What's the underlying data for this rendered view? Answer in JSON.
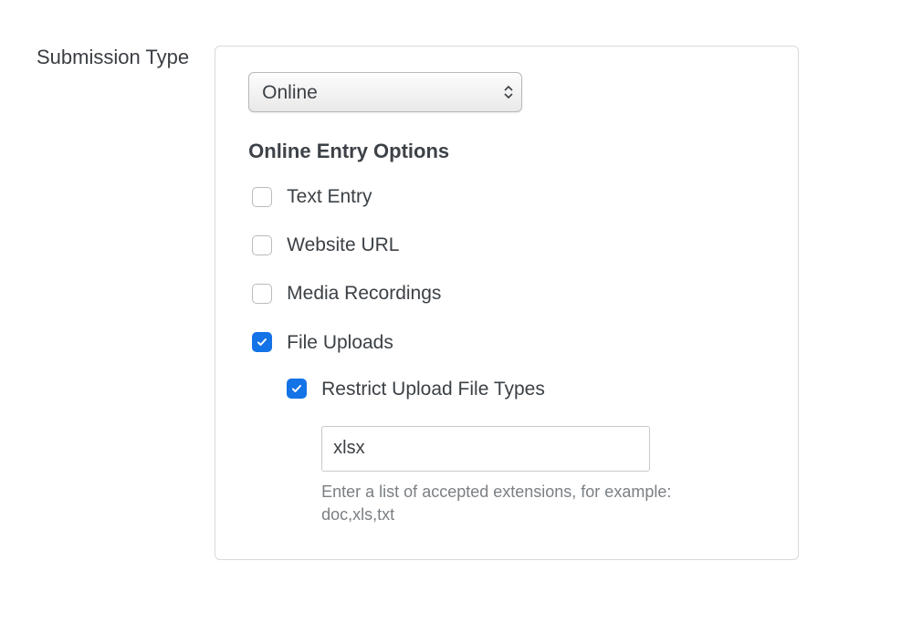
{
  "field_label": "Submission Type",
  "submission_type_value": "Online",
  "section_heading": "Online Entry Options",
  "options": {
    "text_entry": {
      "label": "Text Entry",
      "checked": false
    },
    "website_url": {
      "label": "Website URL",
      "checked": false
    },
    "media_recordings": {
      "label": "Media Recordings",
      "checked": false
    },
    "file_uploads": {
      "label": "File Uploads",
      "checked": true
    },
    "restrict_types": {
      "label": "Restrict Upload File Types",
      "checked": true
    }
  },
  "extensions": {
    "value": "xlsx",
    "hint": "Enter a list of accepted extensions, for example: doc,xls,txt"
  }
}
